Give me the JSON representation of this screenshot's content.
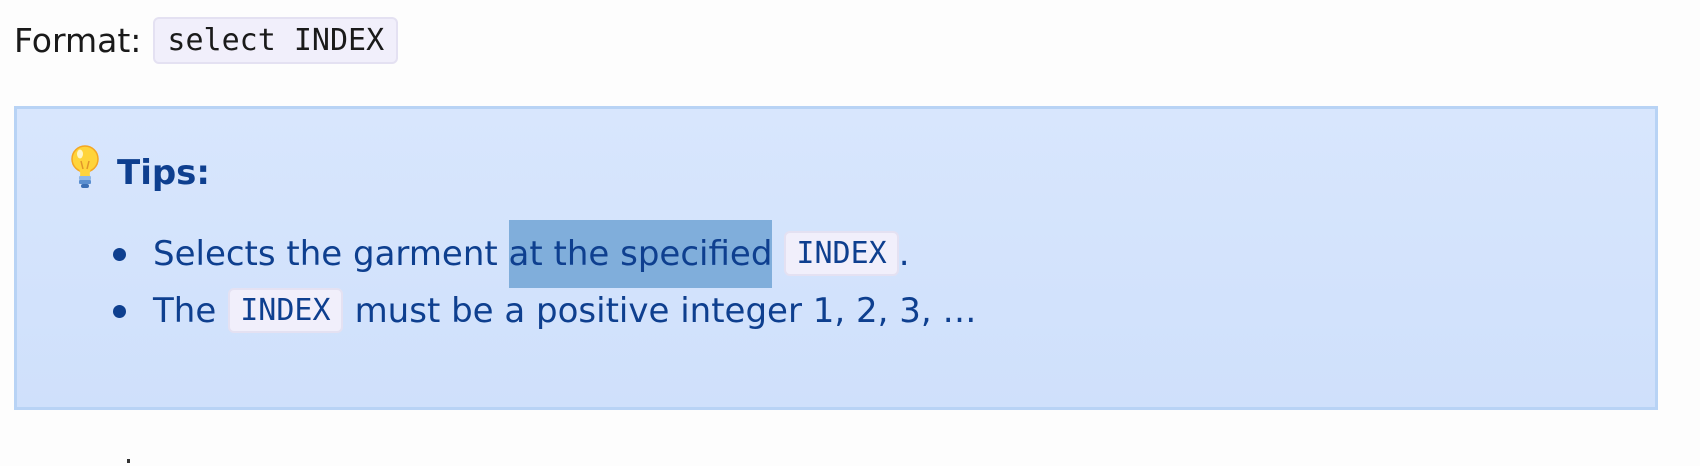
{
  "format": {
    "label": "Format:",
    "code": "select INDEX"
  },
  "tips": {
    "icon": "light-bulb-icon",
    "title": "Tips:",
    "items": [
      {
        "before": "Selects the garment ",
        "selected": "at the specified",
        "code": "INDEX",
        "after": "."
      },
      {
        "before": "The",
        "code": "INDEX",
        "after": "must be a positive integer 1, 2, 3, …"
      }
    ]
  },
  "colors": {
    "tip_background": "#d8e6fd",
    "tip_border": "#b8d3f5",
    "tip_text": "#0e3f8f",
    "selection": "#80aedb",
    "code_background": "#f1effb"
  }
}
